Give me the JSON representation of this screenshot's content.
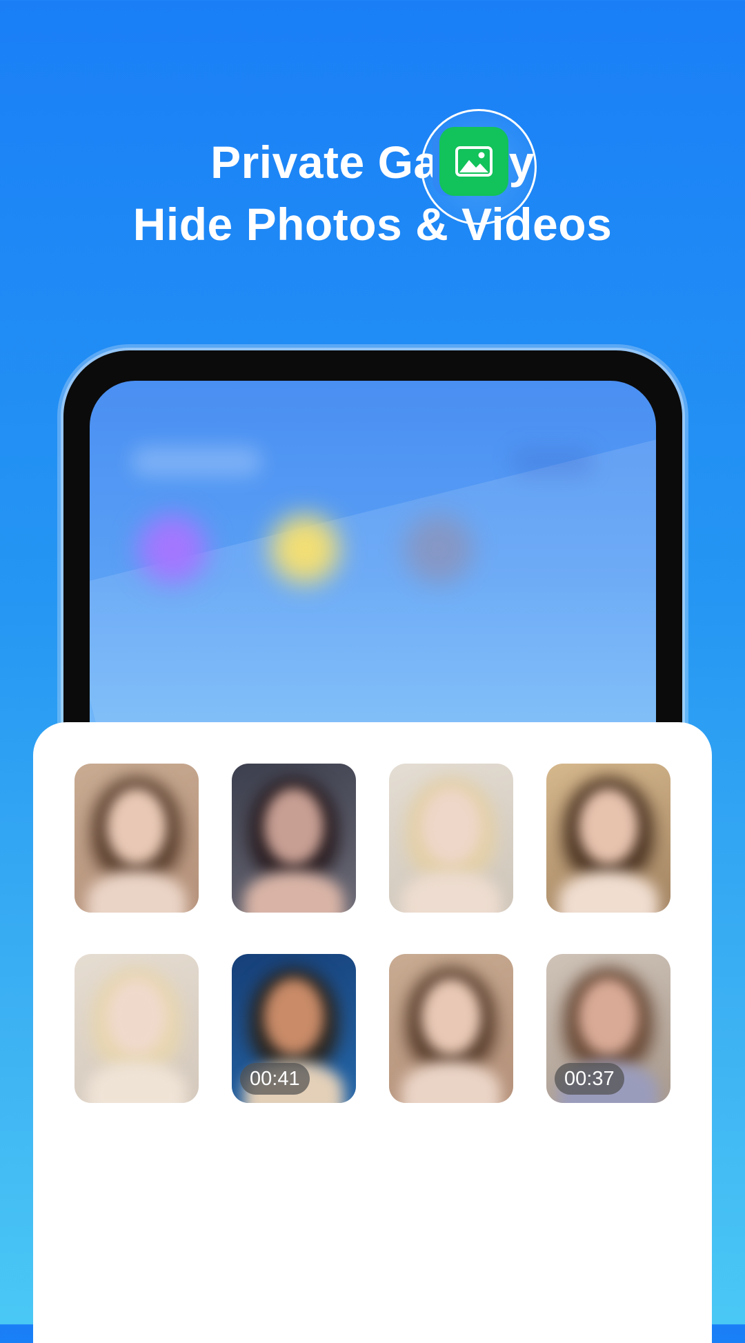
{
  "headline": {
    "line1": "Private Gallery",
    "line2": "Hide Photos & Videos"
  },
  "phone": {
    "highlighted_app_icon": "image-gallery-icon",
    "highlighted_app_color": "#12c25a"
  },
  "gallery": {
    "items": [
      {
        "type": "photo",
        "duration": ""
      },
      {
        "type": "photo",
        "duration": ""
      },
      {
        "type": "photo",
        "duration": ""
      },
      {
        "type": "photo",
        "duration": ""
      },
      {
        "type": "photo",
        "duration": ""
      },
      {
        "type": "video",
        "duration": "00:41"
      },
      {
        "type": "photo",
        "duration": ""
      },
      {
        "type": "video",
        "duration": "00:37"
      }
    ]
  },
  "colors": {
    "background_top": "#1a7ff7",
    "background_bottom": "#4ac8f5",
    "card": "#ffffff"
  }
}
